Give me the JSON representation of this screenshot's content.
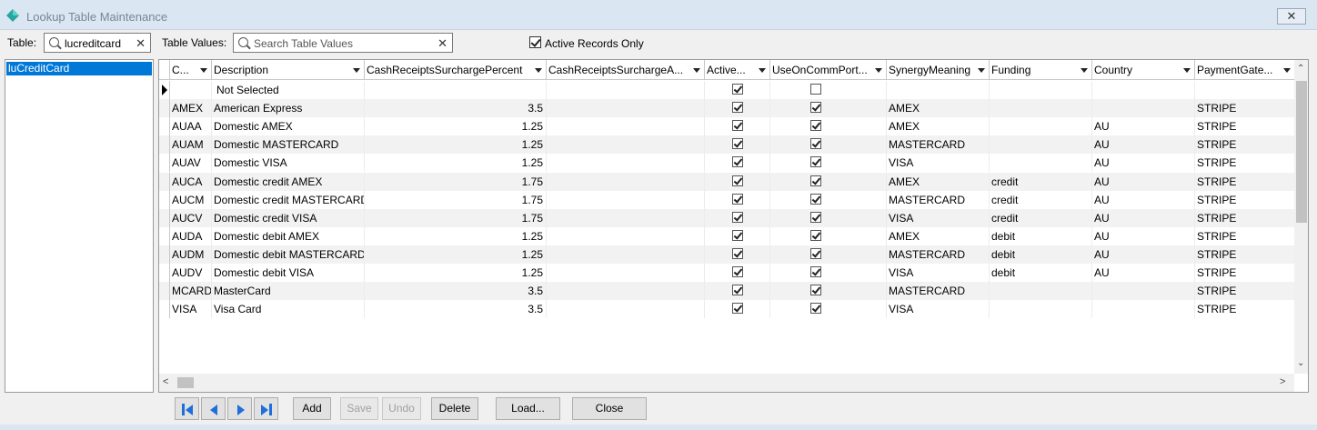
{
  "window": {
    "title": "Lookup Table Maintenance",
    "close_label": "✕"
  },
  "filters": {
    "table_label": "Table:",
    "table_value": "lucreditcard",
    "values_label": "Table Values:",
    "values_placeholder": "Search Table Values",
    "active_only_label": "Active Records Only",
    "active_only_checked": true
  },
  "tables_list": {
    "selected": "luCreditCard"
  },
  "grid": {
    "columns": [
      "C...",
      "Description",
      "CashReceiptsSurchargePercent",
      "CashReceiptsSurchargeA...",
      "Active...",
      "UseOnCommPort...",
      "SynergyMeaning",
      "Funding",
      "Country",
      "PaymentGate..."
    ],
    "rows": [
      {
        "code": "",
        "desc": "Not Selected",
        "pct": "",
        "amt": "",
        "active": true,
        "comm": false,
        "meaning": "",
        "funding": "",
        "country": "",
        "gateway": ""
      },
      {
        "code": "AMEX",
        "desc": "American Express",
        "pct": "3.5",
        "amt": "",
        "active": true,
        "comm": true,
        "meaning": "AMEX",
        "funding": "",
        "country": "",
        "gateway": "STRIPE"
      },
      {
        "code": "AUAA",
        "desc": "Domestic AMEX",
        "pct": "1.25",
        "amt": "",
        "active": true,
        "comm": true,
        "meaning": "AMEX",
        "funding": "",
        "country": "AU",
        "gateway": "STRIPE"
      },
      {
        "code": "AUAM",
        "desc": "Domestic MASTERCARD",
        "pct": "1.25",
        "amt": "",
        "active": true,
        "comm": true,
        "meaning": "MASTERCARD",
        "funding": "",
        "country": "AU",
        "gateway": "STRIPE"
      },
      {
        "code": "AUAV",
        "desc": "Domestic VISA",
        "pct": "1.25",
        "amt": "",
        "active": true,
        "comm": true,
        "meaning": "VISA",
        "funding": "",
        "country": "AU",
        "gateway": "STRIPE"
      },
      {
        "code": "AUCA",
        "desc": "Domestic credit AMEX",
        "pct": "1.75",
        "amt": "",
        "active": true,
        "comm": true,
        "meaning": "AMEX",
        "funding": "credit",
        "country": "AU",
        "gateway": "STRIPE"
      },
      {
        "code": "AUCM",
        "desc": "Domestic credit MASTERCARD",
        "pct": "1.75",
        "amt": "",
        "active": true,
        "comm": true,
        "meaning": "MASTERCARD",
        "funding": "credit",
        "country": "AU",
        "gateway": "STRIPE"
      },
      {
        "code": "AUCV",
        "desc": "Domestic credit VISA",
        "pct": "1.75",
        "amt": "",
        "active": true,
        "comm": true,
        "meaning": "VISA",
        "funding": "credit",
        "country": "AU",
        "gateway": "STRIPE"
      },
      {
        "code": "AUDA",
        "desc": "Domestic debit AMEX",
        "pct": "1.25",
        "amt": "",
        "active": true,
        "comm": true,
        "meaning": "AMEX",
        "funding": "debit",
        "country": "AU",
        "gateway": "STRIPE"
      },
      {
        "code": "AUDM",
        "desc": "Domestic debit MASTERCARD",
        "pct": "1.25",
        "amt": "",
        "active": true,
        "comm": true,
        "meaning": "MASTERCARD",
        "funding": "debit",
        "country": "AU",
        "gateway": "STRIPE"
      },
      {
        "code": "AUDV",
        "desc": "Domestic debit VISA",
        "pct": "1.25",
        "amt": "",
        "active": true,
        "comm": true,
        "meaning": "VISA",
        "funding": "debit",
        "country": "AU",
        "gateway": "STRIPE"
      },
      {
        "code": "MCARD",
        "desc": "MasterCard",
        "pct": "3.5",
        "amt": "",
        "active": true,
        "comm": true,
        "meaning": "MASTERCARD",
        "funding": "",
        "country": "",
        "gateway": "STRIPE"
      },
      {
        "code": "VISA",
        "desc": "Visa Card",
        "pct": "3.5",
        "amt": "",
        "active": true,
        "comm": true,
        "meaning": "VISA",
        "funding": "",
        "country": "",
        "gateway": "STRIPE"
      }
    ]
  },
  "buttons": {
    "add": "Add",
    "save": "Save",
    "undo": "Undo",
    "delete": "Delete",
    "load": "Load...",
    "close": "Close"
  },
  "colors": {
    "selection": "#0078d7",
    "nav_arrow": "#1e6fd9",
    "titlebar": "#dbe6f3"
  },
  "icons": {
    "app": "diamond-icon",
    "search": "search-icon",
    "clear": "close-icon",
    "first": "first-record-icon",
    "prev": "prev-record-icon",
    "next": "next-record-icon",
    "last": "last-record-icon"
  }
}
